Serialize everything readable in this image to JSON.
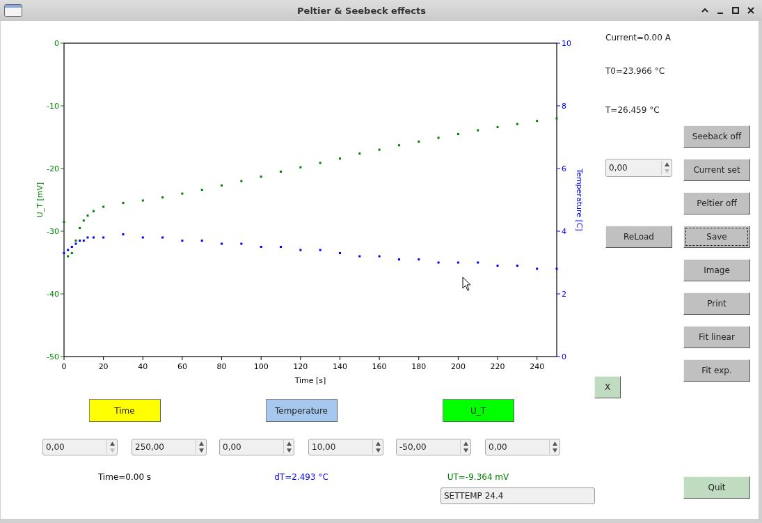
{
  "window": {
    "title": "Peltier & Seebeck effects"
  },
  "chart": {
    "chart_data": {
      "type": "scatter",
      "xlabel": "Time [s]",
      "ylabel": "U_T [mV]",
      "y2label": "Temperature [C]",
      "x": [
        0,
        2,
        4,
        6,
        8,
        10,
        12,
        15,
        20,
        30,
        40,
        50,
        60,
        70,
        80,
        90,
        100,
        110,
        120,
        130,
        140,
        150,
        160,
        170,
        180,
        190,
        200,
        210,
        220,
        230,
        240,
        250
      ],
      "series": [
        {
          "color": "#008000",
          "values": [
            -28.5,
            -34,
            -33.5,
            -31.5,
            -29.5,
            -28.3,
            -27.5,
            -26.8,
            -26.1,
            -25.5,
            -25.1,
            -24.6,
            -24.0,
            -23.4,
            -22.7,
            -22.0,
            -21.3,
            -20.5,
            -19.8,
            -19.1,
            -18.4,
            -17.6,
            -17.0,
            -16.3,
            -15.7,
            -15.1,
            -14.5,
            -13.9,
            -13.4,
            -12.9,
            -12.4,
            -12.0
          ]
        },
        {
          "color": "#0000ff",
          "axis": "y2",
          "values": [
            3.3,
            3.4,
            3.5,
            3.6,
            3.7,
            3.7,
            3.8,
            3.8,
            3.8,
            3.9,
            3.8,
            3.8,
            3.7,
            3.7,
            3.6,
            3.6,
            3.5,
            3.5,
            3.4,
            3.4,
            3.3,
            3.2,
            3.2,
            3.1,
            3.1,
            3.0,
            3.0,
            3.0,
            2.9,
            2.9,
            2.8,
            2.8
          ]
        }
      ],
      "xlim": [
        0,
        250
      ],
      "ylim": [
        -50,
        0
      ],
      "y2lim": [
        0,
        10
      ],
      "xticks": [
        0,
        20,
        40,
        60,
        80,
        100,
        120,
        140,
        160,
        180,
        200,
        220,
        240
      ],
      "yticks": [
        0,
        -10,
        -20,
        -30,
        -40,
        -50
      ],
      "y2ticks": [
        0,
        2,
        4,
        6,
        8,
        10
      ]
    }
  },
  "axis_groups": [
    {
      "button": {
        "label": "Time",
        "color": "#ffff00"
      },
      "fields": [
        {
          "value": "0,00",
          "down_disabled": true
        },
        {
          "value": "250,00",
          "down_disabled": false
        }
      ],
      "readout": {
        "text": "Time=0.00 s",
        "color": "#000000"
      }
    },
    {
      "button": {
        "label": "Temperature",
        "color": "#a6c8ee"
      },
      "fields": [
        {
          "value": "0,00",
          "down_disabled": false
        },
        {
          "value": "10,00",
          "down_disabled": false
        }
      ],
      "readout": {
        "text": "dT=2.493 °C",
        "color": "#0000ff"
      }
    },
    {
      "button": {
        "label": "U_T",
        "color": "#00ff00"
      },
      "fields": [
        {
          "value": "-50,00",
          "down_disabled": false
        },
        {
          "value": "0,00",
          "down_disabled": false
        }
      ],
      "readout": {
        "text": "UT=-9.364 mV",
        "color": "#008000"
      }
    }
  ],
  "command_field": {
    "value": "SETTEMP 24.4"
  },
  "status": [
    "Current=0.00 A",
    "T0=23.966 °C",
    "T=26.459 °C"
  ],
  "current_field": {
    "value": "0,00",
    "down_disabled": true
  },
  "reload_button": {
    "label": "ReLoad"
  },
  "side_buttons": [
    {
      "label": "Seeback off",
      "focused": false
    },
    {
      "label": "Current set",
      "focused": false
    },
    {
      "label": "Peltier off",
      "focused": false
    },
    {
      "label": "Save",
      "focused": true
    },
    {
      "label": "Image",
      "focused": false
    },
    {
      "label": "Print",
      "focused": false
    },
    {
      "label": "Fit linear",
      "focused": false
    },
    {
      "label": "Fit exp.",
      "focused": false
    }
  ],
  "clear_button": {
    "label": "X"
  },
  "quit_button": {
    "label": "Quit"
  }
}
